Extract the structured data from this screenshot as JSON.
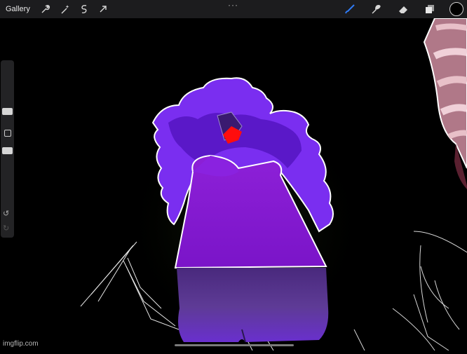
{
  "topbar": {
    "gallery_label": "Gallery",
    "more_glyph": "···"
  },
  "tools_left": [
    "wrench-icon",
    "magic-wand-icon",
    "selection-icon",
    "transform-arrow-icon"
  ],
  "tools_right": [
    "brush-icon",
    "smudge-icon",
    "eraser-icon",
    "layers-icon"
  ],
  "colors": {
    "topbar_bg": "#1c1c1e",
    "canvas_bg": "#000000",
    "active_tool": "#2f7bf6",
    "current_color": "#000000"
  },
  "sidebar": {
    "controls": [
      "brush-size-slider",
      "modify-button",
      "opacity-slider",
      "undo-button",
      "redo-button"
    ],
    "undo_glyph": "↺",
    "redo_glyph": "↻"
  },
  "watermark": "imgflip.com"
}
